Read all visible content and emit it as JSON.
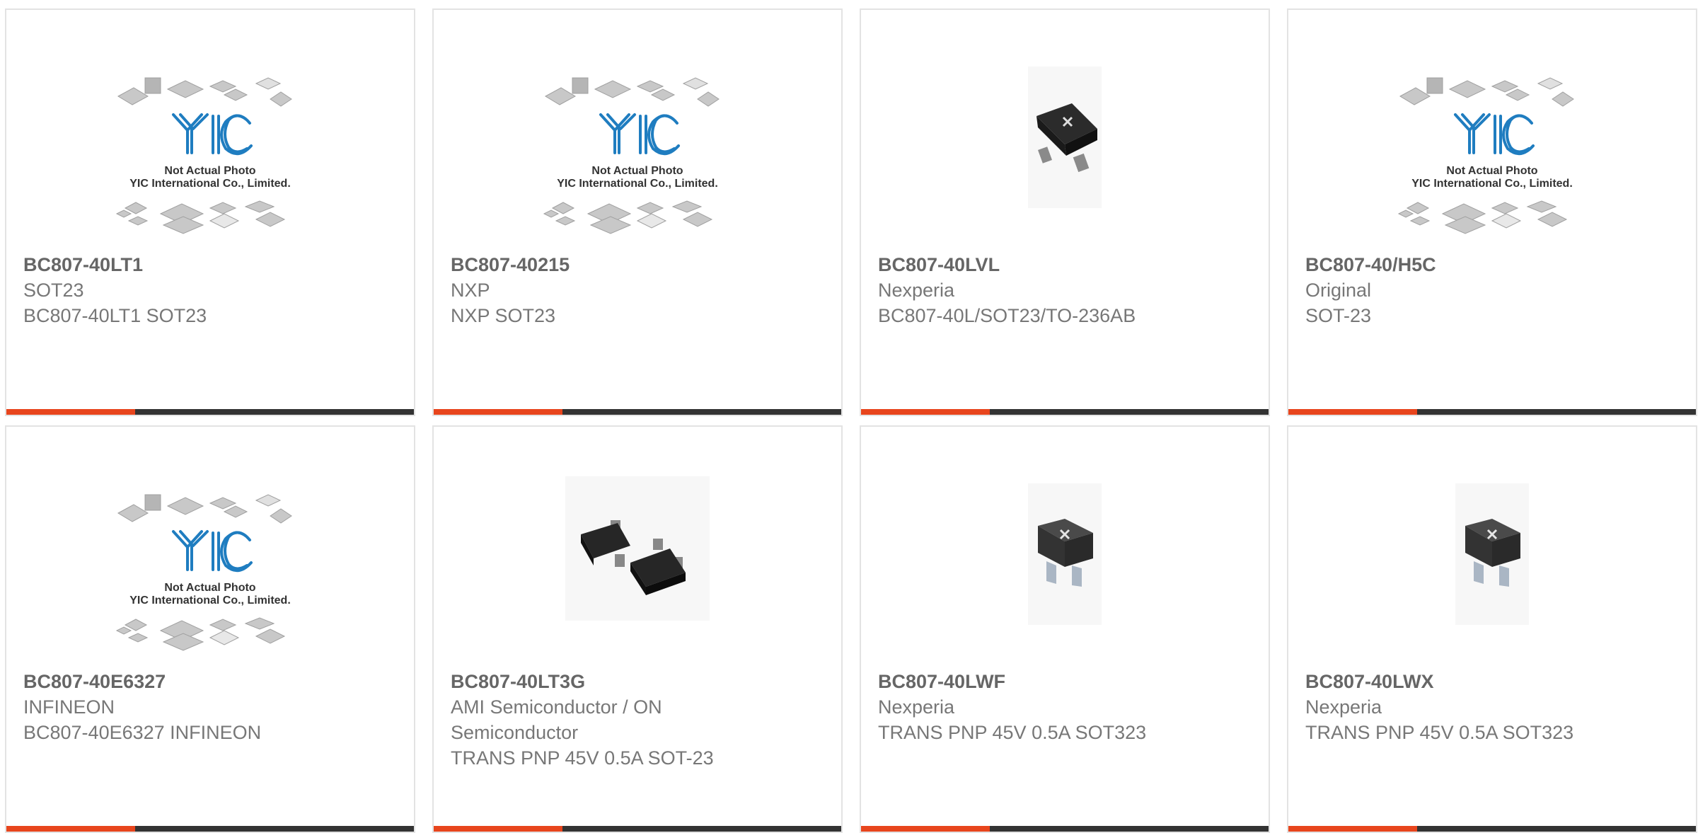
{
  "colors": {
    "accent": "#e8451d",
    "bar": "#333333",
    "border": "#e3e3e3",
    "title": "#666666",
    "text": "#777777"
  },
  "placeholder": {
    "line1": "Not Actual Photo",
    "line2": "YIC International Co., Limited."
  },
  "products": [
    {
      "part": "BC807-40LT1",
      "line1": "SOT23",
      "line2": "BC807-40LT1 SOT23",
      "line3": "",
      "image": "yic-placeholder"
    },
    {
      "part": "BC807-40215",
      "line1": "NXP",
      "line2": "NXP SOT23",
      "line3": "",
      "image": "yic-placeholder"
    },
    {
      "part": "BC807-40LVL",
      "line1": "Nexperia",
      "line2": "BC807-40L/SOT23/TO-236AB",
      "line3": "",
      "image": "nexperia-sot23-chip"
    },
    {
      "part": "BC807-40/H5C",
      "line1": "Original",
      "line2": "SOT-23",
      "line3": "",
      "image": "yic-placeholder"
    },
    {
      "part": "BC807-40E6327",
      "line1": "INFINEON",
      "line2": "BC807-40E6327 INFINEON",
      "line3": "",
      "image": "yic-placeholder"
    },
    {
      "part": "BC807-40LT3G",
      "line1": "AMI Semiconductor / ON",
      "line2": "Semiconductor",
      "line3": "TRANS PNP 45V 0.5A SOT-23",
      "image": "two-sot23-chips"
    },
    {
      "part": "BC807-40LWF",
      "line1": "Nexperia",
      "line2": "TRANS PNP 45V 0.5A SOT323",
      "line3": "",
      "image": "nexperia-sot323-chip"
    },
    {
      "part": "BC807-40LWX",
      "line1": "Nexperia",
      "line2": "TRANS PNP 45V 0.5A SOT323",
      "line3": "",
      "image": "nexperia-sot323-chip"
    }
  ]
}
